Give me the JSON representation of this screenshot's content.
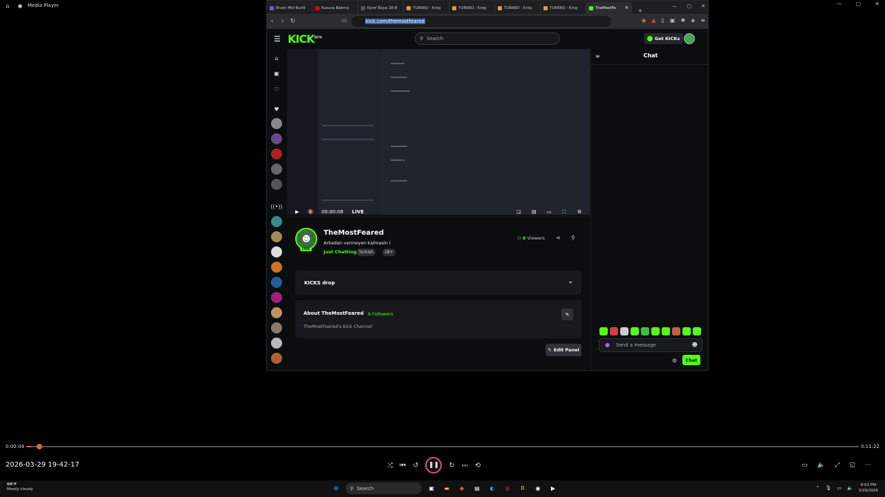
{
  "media_player": {
    "app_title": "Media Player",
    "time_current": "0:00:04",
    "time_total": "0:11:22",
    "progress_fraction": 0.006,
    "file_name": "2026-03-29 19-42-17"
  },
  "browser": {
    "tabs": [
      {
        "label": "Riven Mid Build",
        "color": "#6a5acd"
      },
      {
        "label": "Kusura Bakma",
        "color": "#ff0000"
      },
      {
        "label": "Eşref Rüya 38.B",
        "color": "#3a3a3a"
      },
      {
        "label": "TURKKO - Knig",
        "color": "#e0a030"
      },
      {
        "label": "TURKKO - Knig",
        "color": "#e0a030"
      },
      {
        "label": "TURKKO - Knig",
        "color": "#e0a030"
      },
      {
        "label": "TURKKO - Knig",
        "color": "#e0a030"
      },
      {
        "label": "TheMostFe",
        "color": "#53fc18",
        "active": true
      }
    ],
    "url": "kick.com/themostfeared"
  },
  "kick": {
    "search_placeholder": "Search",
    "get_kicks": "Get KICKs",
    "chat_title": "Chat",
    "video_time": "00:00:08",
    "live_label": "LIVE",
    "channel": {
      "name": "TheMostFeared",
      "live_badge": "LIVE",
      "stream_title": "Arkadan vermeyen kalmasin l",
      "category": "Just Chatting",
      "tags": [
        "Turkish",
        "18+"
      ],
      "viewers_count": "0",
      "viewers_label": "Viewers"
    },
    "kicks_drop": "KICKS drop",
    "about": {
      "title": "About TheMostFeared",
      "followers_count": "6",
      "followers_label": "Followers",
      "description": "TheMostFeared's Kick Channel"
    },
    "edit_panel": "Edit Panel",
    "message_placeholder": "Send a message",
    "chat_button": "Chat"
  },
  "taskbar": {
    "weather_temp": "69°F",
    "weather_desc": "Mostly cloudy",
    "search_label": "Search",
    "time": "8:03 PM",
    "date": "3/29/2026"
  },
  "colors": {
    "kick_green": "#53fc18",
    "seek_orange": "#d66a3a"
  }
}
